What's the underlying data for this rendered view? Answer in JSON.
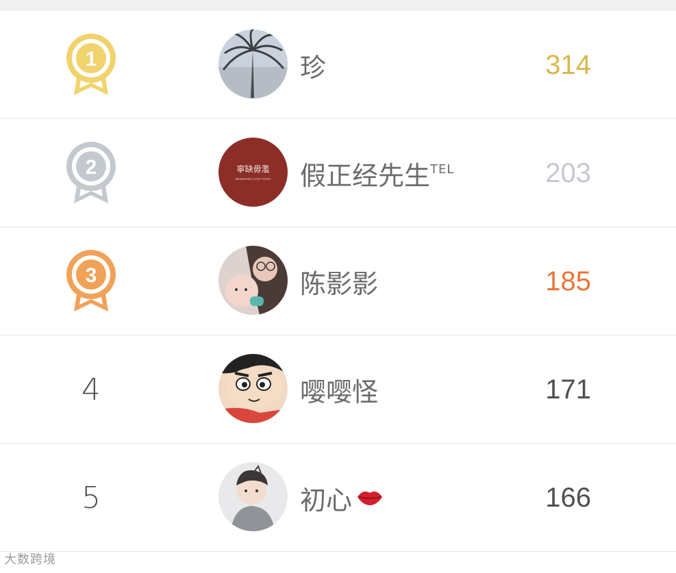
{
  "rows": [
    {
      "rank": "1",
      "name": "珍",
      "name_suffix": "",
      "score": "314",
      "score_color": "#d8b84a",
      "medal_color": "#f1d36e"
    },
    {
      "rank": "2",
      "name": "假正经先生",
      "name_suffix": "TEL",
      "score": "203",
      "score_color": "#c5c8cf",
      "medal_color": "#c4c8cf"
    },
    {
      "rank": "3",
      "name": "陈影影",
      "name_suffix": "",
      "score": "185",
      "score_color": "#e9763a",
      "medal_color": "#f0a259"
    },
    {
      "rank": "4",
      "name": "嘤嘤怪",
      "name_suffix": "",
      "score": "171",
      "score_color": "#4f4f4f"
    },
    {
      "rank": "5",
      "name": "初心",
      "name_suffix": "",
      "score": "166",
      "score_color": "#4f4f4f"
    }
  ],
  "avatar2_text": "寧缺毋濫",
  "avatar2_subtext": "DESERVES LOST FAITH",
  "icons": {
    "rank1": "gold-medal-icon",
    "rank2": "silver-medal-icon",
    "rank3": "bronze-medal-icon",
    "lips": "kiss-lips-icon"
  },
  "watermark": "大数跨境"
}
